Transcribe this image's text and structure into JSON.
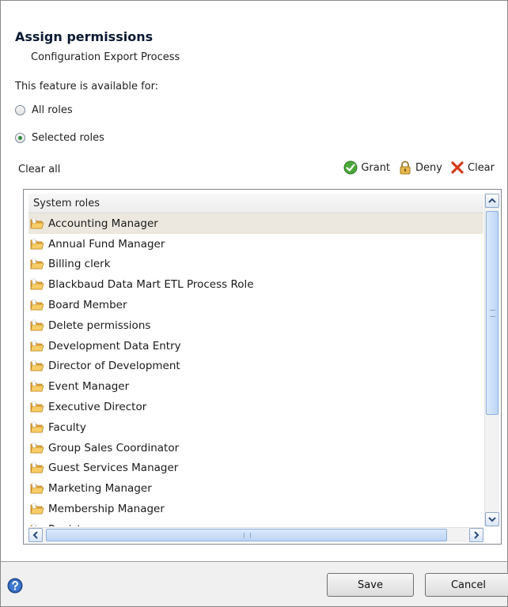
{
  "dialog": {
    "title": "Assign permissions",
    "subtitle": "Configuration Export Process",
    "availability_label": "This feature is available for:"
  },
  "options": {
    "all_roles": "All roles",
    "selected_roles": "Selected roles",
    "selected": "selected_roles"
  },
  "toolbar": {
    "clear_all": "Clear all",
    "grant": "Grant",
    "deny": "Deny",
    "clear": "Clear"
  },
  "list": {
    "header": "System roles",
    "items": [
      "Accounting Manager",
      "Annual Fund Manager",
      "Billing clerk",
      "Blackbaud Data Mart ETL Process Role",
      "Board Member",
      "Delete permissions",
      "Development Data Entry",
      "Director of Development",
      "Event Manager",
      "Executive Director",
      "Faculty",
      "Group Sales Coordinator",
      "Guest Services Manager",
      "Marketing Manager",
      "Membership Manager",
      "Registrar"
    ],
    "selected_index": 0
  },
  "footer": {
    "save": "Save",
    "cancel": "Cancel"
  },
  "colors": {
    "grant": "#3a9a2e",
    "deny": "#d6a84a",
    "clear": "#d23b1a",
    "selected_row": "#ece8df",
    "help": "#2a5caa"
  }
}
